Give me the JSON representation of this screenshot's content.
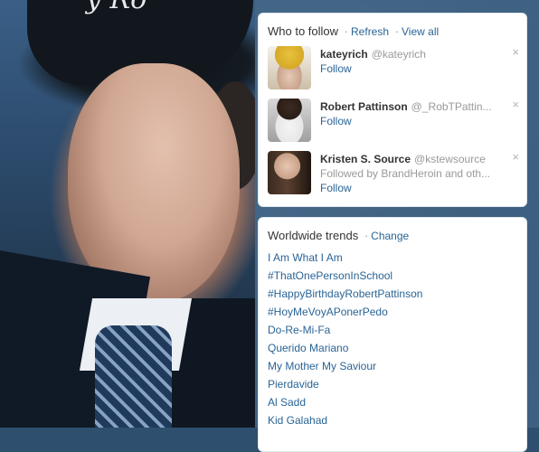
{
  "background": {
    "cursive_text": "y Ro"
  },
  "who_to_follow": {
    "title": "Who to follow",
    "sep": "·",
    "refresh_label": "Refresh",
    "view_all_label": "View all",
    "users": [
      {
        "name": "kateyrich",
        "handle": "@kateyrich",
        "sub": "",
        "follow_label": "Follow",
        "close_label": "×"
      },
      {
        "name": "Robert Pattinson",
        "handle": "@_RobTPattin...",
        "sub": "",
        "follow_label": "Follow",
        "close_label": "×"
      },
      {
        "name": "Kristen S. Source",
        "handle": "@kstewsource",
        "sub": "Followed by BrandHeroin and oth...",
        "follow_label": "Follow",
        "close_label": "×"
      }
    ]
  },
  "trends": {
    "title": "Worldwide trends",
    "sep": "·",
    "change_label": "Change",
    "items": [
      "I Am What I Am",
      "#ThatOnePersonInSchool",
      "#HappyBirthdayRobertPattinson",
      "#HoyMeVoyAPonerPedo",
      "Do-Re-Mi-Fa",
      "Querido Mariano",
      "My Mother My Saviour",
      "Pierdavide",
      "Al Sadd",
      "Kid Galahad"
    ]
  }
}
